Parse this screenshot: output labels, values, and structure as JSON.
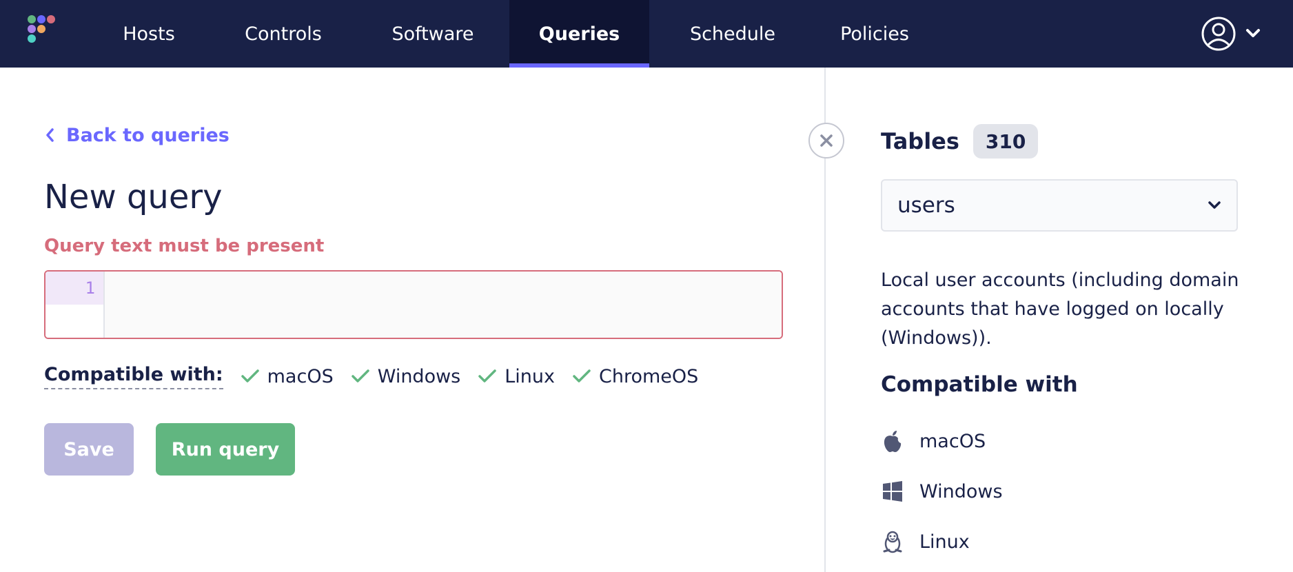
{
  "nav": {
    "items": [
      {
        "label": "Hosts"
      },
      {
        "label": "Controls"
      },
      {
        "label": "Software"
      },
      {
        "label": "Queries"
      },
      {
        "label": "Schedule"
      },
      {
        "label": "Policies"
      }
    ],
    "active": "Queries"
  },
  "colors": {
    "nav_bg": "#192147",
    "accent": "#6a67fe",
    "error": "#d66c7b",
    "success": "#61b680",
    "disabled": "#b9b7dd"
  },
  "main": {
    "back_label": "Back to queries",
    "title": "New query",
    "error": "Query text must be present",
    "editor": {
      "line_number": "1",
      "value": ""
    },
    "compatible_label": "Compatible with:",
    "platforms": [
      "macOS",
      "Windows",
      "Linux",
      "ChromeOS"
    ],
    "save_label": "Save",
    "run_label": "Run query"
  },
  "sidebar": {
    "tables_label": "Tables",
    "tables_count": "310",
    "selected_table": "users",
    "description": "Local user accounts (including domain accounts that have logged on locally (Windows)).",
    "compatible_title": "Compatible with",
    "platforms": [
      {
        "name": "macOS",
        "icon": "apple-icon"
      },
      {
        "name": "Windows",
        "icon": "windows-icon"
      },
      {
        "name": "Linux",
        "icon": "linux-icon"
      }
    ]
  }
}
